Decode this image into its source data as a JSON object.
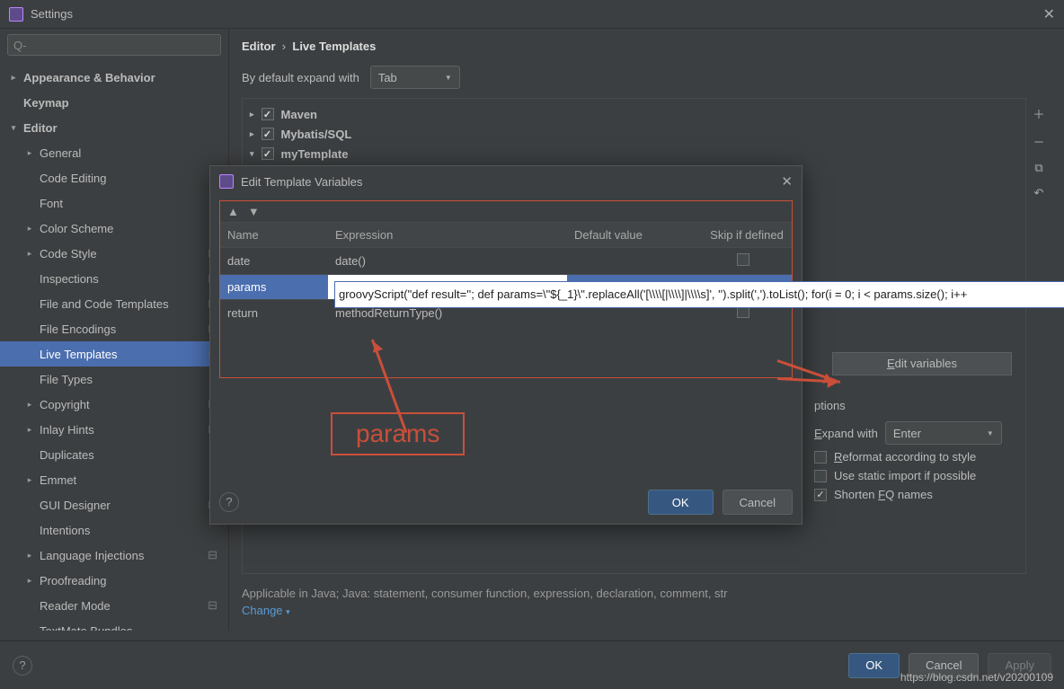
{
  "title": "Settings",
  "search_placeholder": "Q-",
  "breadcrumb": {
    "a": "Editor",
    "sep": "›",
    "b": "Live Templates"
  },
  "expand_label": "By default expand with",
  "expand_value": "Tab",
  "tree": [
    {
      "label": "Appearance & Behavior",
      "depth": 0,
      "exp": ">",
      "bold": true
    },
    {
      "label": "Keymap",
      "depth": 0,
      "bold": true
    },
    {
      "label": "Editor",
      "depth": 0,
      "exp": "v",
      "bold": true
    },
    {
      "label": "General",
      "depth": 1,
      "exp": ">"
    },
    {
      "label": "Code Editing",
      "depth": 1
    },
    {
      "label": "Font",
      "depth": 1
    },
    {
      "label": "Color Scheme",
      "depth": 1,
      "exp": ">"
    },
    {
      "label": "Code Style",
      "depth": 1,
      "exp": ">",
      "gear": true
    },
    {
      "label": "Inspections",
      "depth": 1,
      "gear": true
    },
    {
      "label": "File and Code Templates",
      "depth": 1,
      "gear": true
    },
    {
      "label": "File Encodings",
      "depth": 1,
      "gear": true
    },
    {
      "label": "Live Templates",
      "depth": 1,
      "gear": true,
      "sel": true
    },
    {
      "label": "File Types",
      "depth": 1
    },
    {
      "label": "Copyright",
      "depth": 1,
      "exp": ">",
      "gear": true
    },
    {
      "label": "Inlay Hints",
      "depth": 1,
      "exp": ">",
      "gear": true
    },
    {
      "label": "Duplicates",
      "depth": 1
    },
    {
      "label": "Emmet",
      "depth": 1,
      "exp": ">"
    },
    {
      "label": "GUI Designer",
      "depth": 1,
      "gear": true
    },
    {
      "label": "Intentions",
      "depth": 1
    },
    {
      "label": "Language Injections",
      "depth": 1,
      "exp": ">",
      "gear": true
    },
    {
      "label": "Proofreading",
      "depth": 1,
      "exp": ">"
    },
    {
      "label": "Reader Mode",
      "depth": 1,
      "gear": true
    },
    {
      "label": "TextMate Bundles",
      "depth": 1
    }
  ],
  "groups": [
    {
      "label": "Maven"
    },
    {
      "label": "Mybatis/SQL"
    },
    {
      "label": "myTemplate",
      "expanded": true
    }
  ],
  "right": {
    "edit_btn": "Edit variables",
    "options_title": "ptions",
    "expand_with": "Expand with",
    "expand_val": "Enter",
    "reformat": "Reformat according to style",
    "static_import": "Use static import if possible",
    "shorten": "Shorten FQ names"
  },
  "applicable": "Applicable in Java; Java: statement, consumer function, expression, declaration, comment, str",
  "change": "Change",
  "footer": {
    "ok": "OK",
    "cancel": "Cancel",
    "apply": "Apply"
  },
  "dialog": {
    "title": "Edit Template Variables",
    "cols": [
      "Name",
      "Expression",
      "Default value",
      "Skip if defined"
    ],
    "rows": [
      {
        "name": "date",
        "expr": "date()",
        "def": "",
        "skip": false
      },
      {
        "name": "params",
        "expr": "groovyScript(\"def result=''; def params=\\\"${_1}\\\".replaceAll('[\\\\\\\\[|\\\\\\\\]|\\\\\\\\s]', '').split(',').toList(); for(i = 0; i < params.size(); i++",
        "def": "",
        "skip": false,
        "sel": true
      },
      {
        "name": "return",
        "expr": "methodReturnType()",
        "def": "",
        "skip": false
      }
    ],
    "ok": "OK",
    "cancel": "Cancel"
  },
  "callout": "params",
  "watermark": "https://blog.csdn.net/v20200109"
}
